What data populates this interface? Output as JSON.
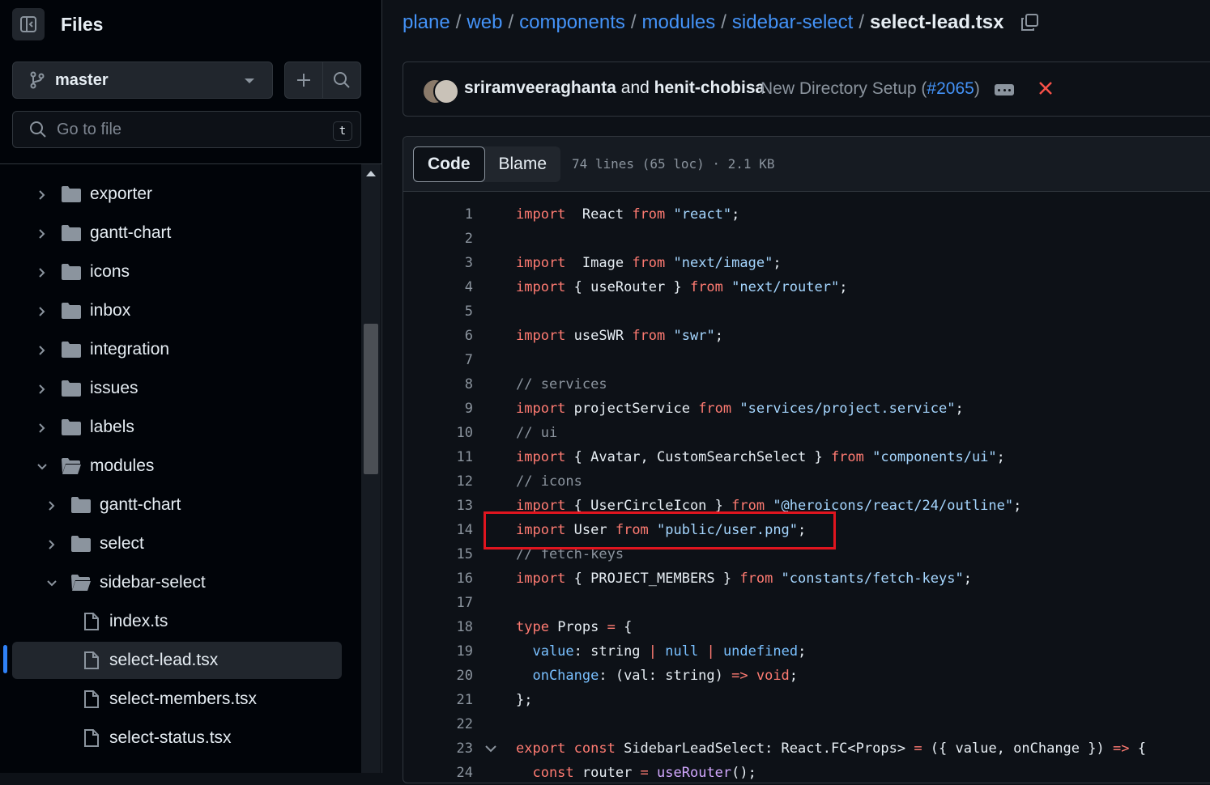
{
  "sidebar": {
    "title": "Files",
    "branch": "master",
    "search": {
      "placeholder": "Go to file",
      "shortcut": "t"
    },
    "tree": [
      {
        "label": "exporter",
        "type": "folder",
        "expanded": false,
        "depth": 0
      },
      {
        "label": "gantt-chart",
        "type": "folder",
        "expanded": false,
        "depth": 0
      },
      {
        "label": "icons",
        "type": "folder",
        "expanded": false,
        "depth": 0
      },
      {
        "label": "inbox",
        "type": "folder",
        "expanded": false,
        "depth": 0
      },
      {
        "label": "integration",
        "type": "folder",
        "expanded": false,
        "depth": 0
      },
      {
        "label": "issues",
        "type": "folder",
        "expanded": false,
        "depth": 0
      },
      {
        "label": "labels",
        "type": "folder",
        "expanded": false,
        "depth": 0
      },
      {
        "label": "modules",
        "type": "folder",
        "expanded": true,
        "depth": 0
      },
      {
        "label": "gantt-chart",
        "type": "folder",
        "expanded": false,
        "depth": 1
      },
      {
        "label": "select",
        "type": "folder",
        "expanded": false,
        "depth": 1
      },
      {
        "label": "sidebar-select",
        "type": "folder",
        "expanded": true,
        "depth": 1
      },
      {
        "label": "index.ts",
        "type": "file",
        "depth": 2
      },
      {
        "label": "select-lead.tsx",
        "type": "file",
        "depth": 2,
        "active": true
      },
      {
        "label": "select-members.tsx",
        "type": "file",
        "depth": 2
      },
      {
        "label": "select-status.tsx",
        "type": "file",
        "depth": 2
      }
    ]
  },
  "breadcrumb": [
    "plane",
    "web",
    "components",
    "modules",
    "sidebar-select"
  ],
  "current_file": "select-lead.tsx",
  "commit": {
    "author1": "sriramveeraghanta",
    "and": "and",
    "author2": "henit-chobisa",
    "message": "New Directory Setup (",
    "pr": "#2065",
    "message_end": ")"
  },
  "viewer": {
    "tab_code": "Code",
    "tab_blame": "Blame",
    "meta": "74 lines (65 loc) · 2.1 KB"
  },
  "code_lines": [
    [
      [
        "kw",
        "import"
      ],
      [
        "",
        "  React "
      ],
      [
        "kw",
        "from"
      ],
      [
        "str",
        " \"react\""
      ],
      [
        "",
        ";"
      ]
    ],
    [],
    [
      [
        "kw",
        "import"
      ],
      [
        "",
        "  Image "
      ],
      [
        "kw",
        "from"
      ],
      [
        "str",
        " \"next/image\""
      ],
      [
        "",
        ";"
      ]
    ],
    [
      [
        "kw",
        "import"
      ],
      [
        "",
        " { useRouter } "
      ],
      [
        "kw",
        "from"
      ],
      [
        "str",
        " \"next/router\""
      ],
      [
        "",
        ";"
      ]
    ],
    [],
    [
      [
        "kw",
        "import"
      ],
      [
        "",
        " useSWR "
      ],
      [
        "kw",
        "from"
      ],
      [
        "str",
        " \"swr\""
      ],
      [
        "",
        ";"
      ]
    ],
    [],
    [
      [
        "cm",
        "// services"
      ]
    ],
    [
      [
        "kw",
        "import"
      ],
      [
        "",
        " projectService "
      ],
      [
        "kw",
        "from"
      ],
      [
        "str",
        " \"services/project.service\""
      ],
      [
        "",
        ";"
      ]
    ],
    [
      [
        "cm",
        "// ui"
      ]
    ],
    [
      [
        "kw",
        "import"
      ],
      [
        "",
        " { Avatar, CustomSearchSelect } "
      ],
      [
        "kw",
        "from"
      ],
      [
        "str",
        " \"components/ui\""
      ],
      [
        "",
        ";"
      ]
    ],
    [
      [
        "cm",
        "// icons"
      ]
    ],
    [
      [
        "kw",
        "import"
      ],
      [
        "",
        " { UserCircleIcon } "
      ],
      [
        "kw",
        "from"
      ],
      [
        "str",
        " \"@heroicons/react/24/outline\""
      ],
      [
        "",
        ";"
      ]
    ],
    [
      [
        "kw",
        "import"
      ],
      [
        "",
        " User "
      ],
      [
        "kw",
        "from"
      ],
      [
        "str",
        " \"public/user.png\""
      ],
      [
        "",
        ";"
      ]
    ],
    [
      [
        "cm",
        "// fetch-keys"
      ]
    ],
    [
      [
        "kw",
        "import"
      ],
      [
        "",
        " { PROJECT_MEMBERS } "
      ],
      [
        "kw",
        "from"
      ],
      [
        "str",
        " \"constants/fetch-keys\""
      ],
      [
        "",
        ";"
      ]
    ],
    [],
    [
      [
        "kw",
        "type"
      ],
      [
        "",
        " Props "
      ],
      [
        "kw",
        "="
      ],
      [
        "",
        " {"
      ]
    ],
    [
      [
        "",
        ""
      ],
      [
        "cst",
        "  value"
      ],
      [
        "",
        ": string "
      ],
      [
        "kw",
        "|"
      ],
      [
        "cst",
        " null"
      ],
      [
        "kw",
        " |"
      ],
      [
        "cst",
        " undefined"
      ],
      [
        "",
        ";"
      ]
    ],
    [
      [
        "cst",
        "  onChange"
      ],
      [
        "",
        ": (val: string) "
      ],
      [
        "kw",
        "=>"
      ],
      [
        "kw",
        " void"
      ],
      [
        "",
        ";"
      ]
    ],
    [
      [
        "",
        "};"
      ]
    ],
    [],
    [
      [
        "kw",
        "export"
      ],
      [
        "kw",
        " const"
      ],
      [
        "",
        " SidebarLeadSelect: React.FC<Props> "
      ],
      [
        "kw",
        "="
      ],
      [
        "",
        " ({ value, onChange }) "
      ],
      [
        "kw",
        "=>"
      ],
      [
        "",
        " {"
      ]
    ],
    [
      [
        "kw",
        "  const"
      ],
      [
        "",
        " router "
      ],
      [
        "kw",
        "="
      ],
      [
        "ent",
        " useRouter"
      ],
      [
        "",
        "();"
      ]
    ]
  ],
  "colors": {
    "accent": "#4493f8",
    "keyword": "#ff7b72",
    "string": "#a5d6ff",
    "highlight": "#e0151f"
  }
}
